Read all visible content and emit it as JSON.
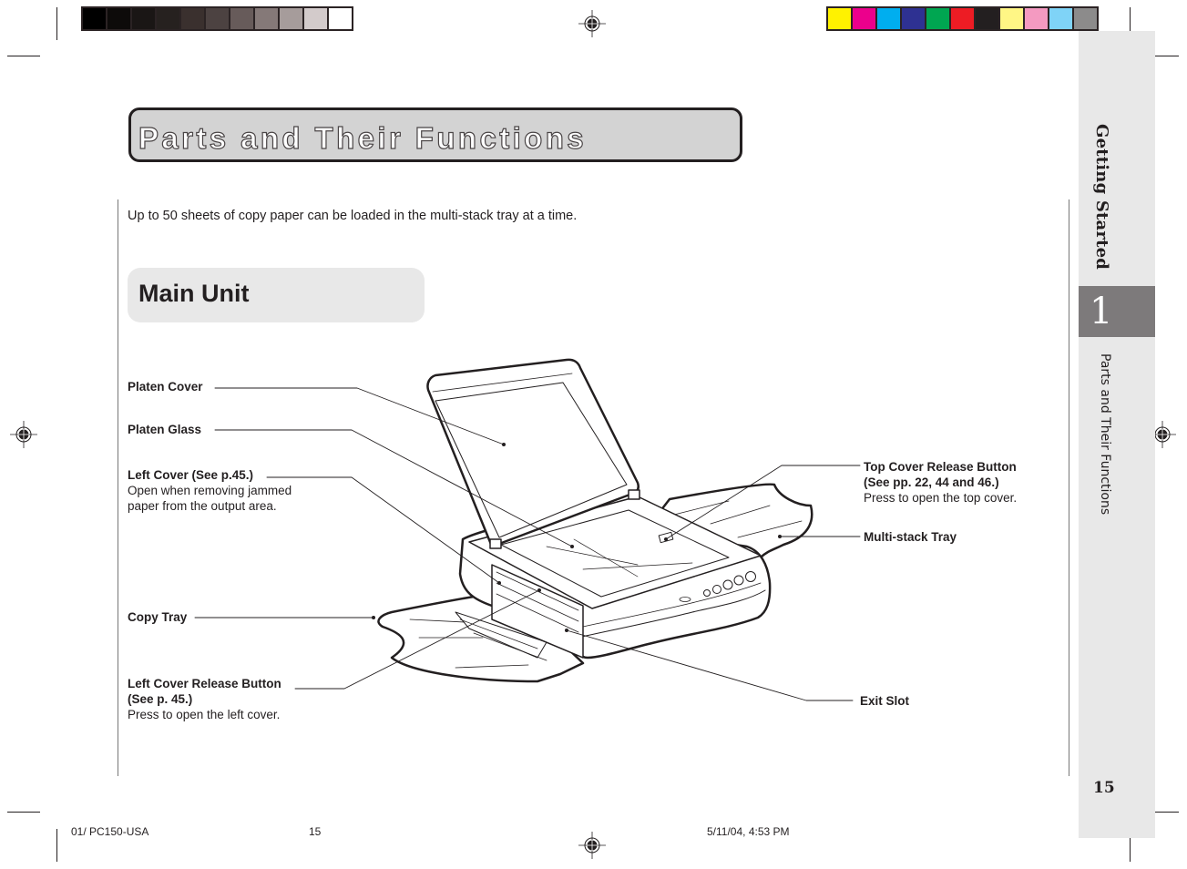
{
  "print_marks": {
    "gray_swatches": [
      "#000000",
      "#0d0b0a",
      "#1a1615",
      "#26211f",
      "#3a302e",
      "#4c4241",
      "#675b5a",
      "#857978",
      "#a69c9b",
      "#d3cbcb",
      "#ffffff"
    ],
    "color_swatches": [
      "#fff200",
      "#ec008c",
      "#00aeef",
      "#2e3192",
      "#00a651",
      "#ed1c24",
      "#231f20",
      "#fff685",
      "#f49ac1",
      "#7fd3f7",
      "#8c8b8b"
    ]
  },
  "header": {
    "title": "Parts and Their Functions"
  },
  "sidebar": {
    "chapter_title": "Getting Started",
    "chapter_number": "1",
    "section_title": "Parts and Their Functions",
    "page_number": "15"
  },
  "body": {
    "intro": "Up to 50 sheets of copy paper can be loaded in the multi-stack tray at a time.",
    "section_heading": "Main Unit"
  },
  "callouts": [
    {
      "id": "platen-cover",
      "label": "Platen Cover",
      "ref": "",
      "desc": ""
    },
    {
      "id": "platen-glass",
      "label": "Platen Glass",
      "ref": "",
      "desc": ""
    },
    {
      "id": "left-cover",
      "label": "Left Cover (See p.45.)",
      "ref": "",
      "desc": "Open when removing jammed paper from the output area."
    },
    {
      "id": "copy-tray",
      "label": "Copy Tray",
      "ref": "",
      "desc": ""
    },
    {
      "id": "left-cover-release",
      "label": "Left Cover Release Button",
      "ref": "(See p. 45.)",
      "desc": "Press to open the left cover."
    },
    {
      "id": "top-cover-release",
      "label": "Top Cover Release Button",
      "ref": "(See pp. 22, 44 and 46.)",
      "desc": "Press to open the top cover."
    },
    {
      "id": "multi-stack-tray",
      "label": "Multi-stack Tray",
      "ref": "",
      "desc": ""
    },
    {
      "id": "exit-slot",
      "label": "Exit Slot",
      "ref": "",
      "desc": ""
    }
  ],
  "footer": {
    "file": "01/ PC150-USA",
    "page": "15",
    "timestamp": "5/11/04, 4:53 PM"
  }
}
